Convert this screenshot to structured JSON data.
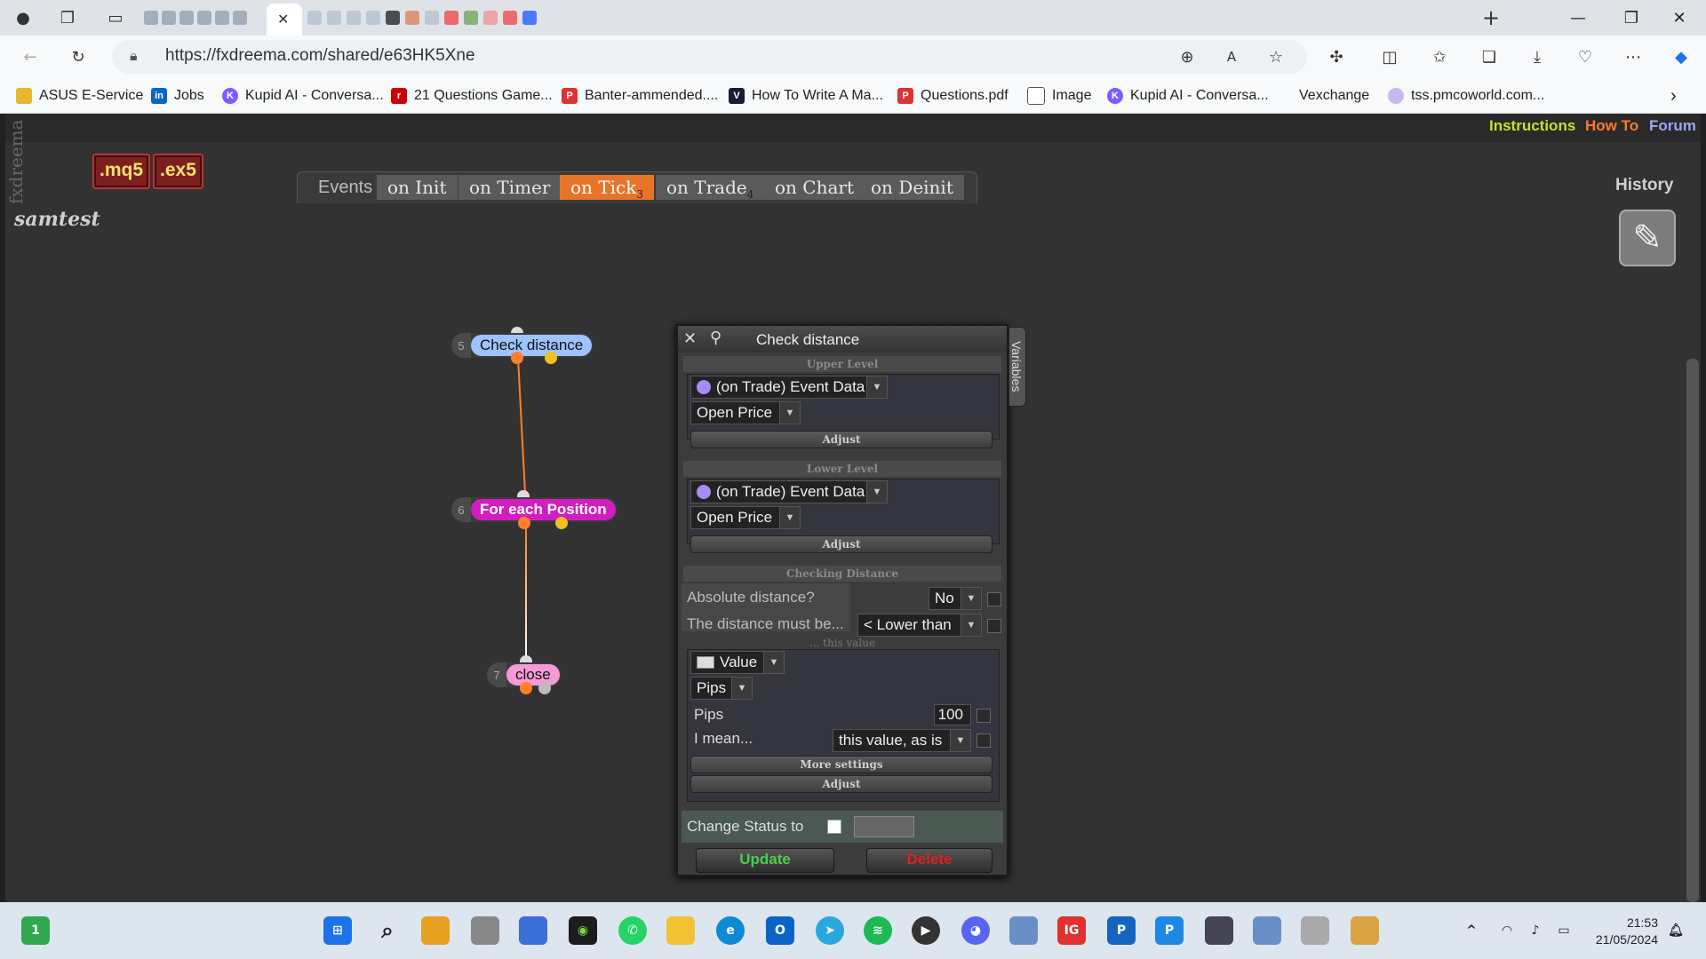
{
  "browser": {
    "url": "https://fxdreema.com/shared/e63HK5Xne",
    "bookmarks": [
      "ASUS E-Service",
      "Jobs",
      "Kupid AI - Conversa...",
      "21 Questions Game...",
      "Banter-ammended....",
      "How To Write A Ma...",
      "Questions.pdf",
      "Image",
      "Kupid AI - Conversa...",
      "Vexchange",
      "tss.pmcoworld.com..."
    ]
  },
  "app": {
    "brand": "fxdreema",
    "links": {
      "instructions": "Instructions",
      "howto": "How To",
      "forum": "Forum"
    },
    "buttons": {
      "mq5": ".mq5",
      "ex5": ".ex5"
    },
    "project": "samtest",
    "tabs_label": "Events",
    "tabs": [
      {
        "label": "on Init",
        "count": ""
      },
      {
        "label": "on Timer",
        "count": ""
      },
      {
        "label": "on Tick",
        "count": "3"
      },
      {
        "label": "on Trade",
        "count": "4"
      },
      {
        "label": "on Chart",
        "count": ""
      },
      {
        "label": "on Deinit",
        "count": ""
      }
    ],
    "history": "History",
    "colors": {
      "accent_tab": "#e8742a",
      "connector": "#ff7f2a"
    }
  },
  "blocks": [
    {
      "num": "5",
      "label": "Check distance"
    },
    {
      "num": "6",
      "label": "For each Position"
    },
    {
      "num": "7",
      "label": "close"
    }
  ],
  "dialog": {
    "title": "Check distance",
    "variables_tab": "Variables",
    "upper": {
      "section": "Upper Level",
      "source": "(on Trade) Event Data",
      "field": "Open Price",
      "adjust": "Adjust"
    },
    "lower": {
      "section": "Lower Level",
      "source": "(on Trade) Event Data",
      "field": "Open Price",
      "adjust": "Adjust"
    },
    "checking": {
      "section": "Checking Distance",
      "absolute_label": "Absolute distance?",
      "absolute_value": "No",
      "must_be_label": "The distance must be...",
      "must_be_value": "< Lower than",
      "this_value": "... this value"
    },
    "value": {
      "type": "Value",
      "unit": "Pips",
      "pips_label": "Pips",
      "pips_value": "100",
      "mean_label": "I mean...",
      "mean_value": "this value, as is",
      "more_settings": "More settings",
      "adjust": "Adjust"
    },
    "status_label": "Change Status to",
    "update": "Update",
    "delete": "Delete"
  },
  "taskbar": {
    "time": "21:53",
    "date": "21/05/2024"
  }
}
